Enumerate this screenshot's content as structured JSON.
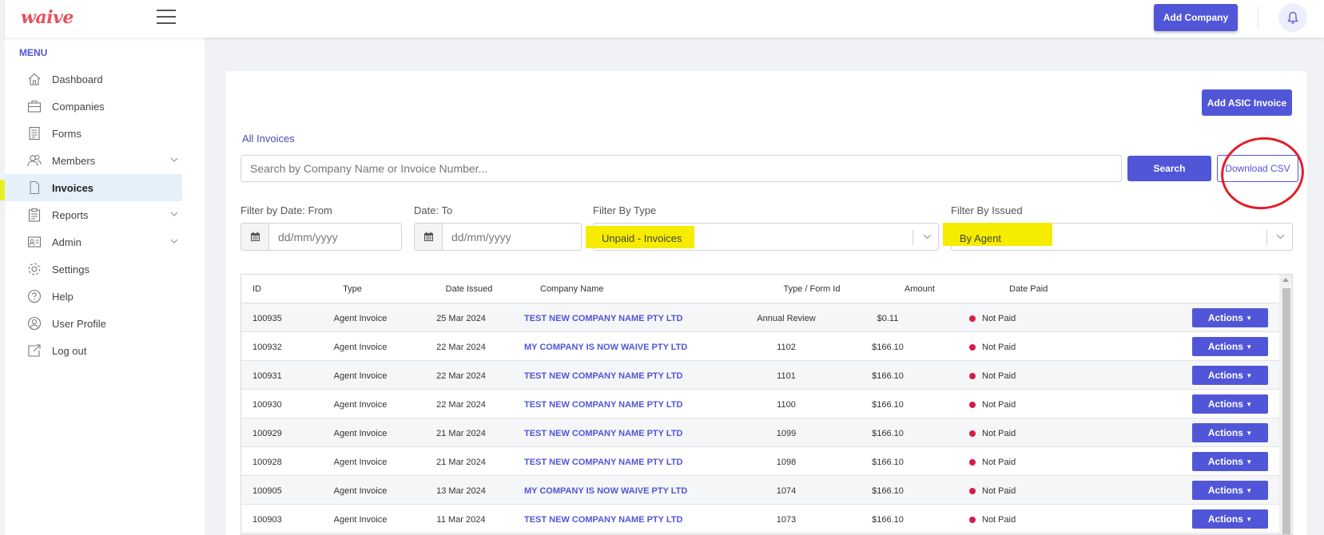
{
  "topbar": {
    "logo": "waive",
    "add_company_label": "Add Company"
  },
  "sidebar": {
    "menu_title": "MENU",
    "items": [
      {
        "label": "Dashboard",
        "icon": "home-icon"
      },
      {
        "label": "Companies",
        "icon": "briefcase-icon"
      },
      {
        "label": "Forms",
        "icon": "forms-icon"
      },
      {
        "label": "Members",
        "icon": "members-icon",
        "expandable": true
      },
      {
        "label": "Invoices",
        "icon": "file-icon",
        "active": true
      },
      {
        "label": "Reports",
        "icon": "clipboard-icon",
        "expandable": true
      },
      {
        "label": "Admin",
        "icon": "admin-icon",
        "expandable": true
      },
      {
        "label": "Settings",
        "icon": "gear-icon"
      },
      {
        "label": "Help",
        "icon": "help-icon"
      },
      {
        "label": "User Profile",
        "icon": "user-icon"
      },
      {
        "label": "Log out",
        "icon": "logout-icon"
      }
    ]
  },
  "main": {
    "add_asic_label": "Add ASIC Invoice",
    "section_title": "All Invoices",
    "search_placeholder": "Search by Company Name or Invoice Number...",
    "search_button": "Search",
    "download_csv_button": "Download CSV",
    "filters": {
      "date_from_label": "Filter by Date: From",
      "date_to_label": "Date: To",
      "date_placeholder": "dd/mm/yyyy",
      "type_label": "Filter By Type",
      "type_value": "Unpaid - Invoices",
      "issued_label": "Filter By Issued",
      "issued_value": "By Agent"
    },
    "table": {
      "columns": [
        "ID",
        "Type",
        "Date Issued",
        "Company Name",
        "Type / Form Id",
        "Amount",
        "Date Paid"
      ],
      "actions_label": "Actions",
      "rows": [
        {
          "id": "100935",
          "type": "Agent Invoice",
          "date": "25 Mar 2024",
          "company": "TEST NEW COMPANY NAME PTY LTD",
          "form": "Annual Review",
          "amount": "$0.11",
          "paid": "Not Paid"
        },
        {
          "id": "100932",
          "type": "Agent Invoice",
          "date": "22 Mar 2024",
          "company": "MY COMPANY IS NOW WAIVE PTY LTD",
          "form": "1102",
          "amount": "$166.10",
          "paid": "Not Paid"
        },
        {
          "id": "100931",
          "type": "Agent Invoice",
          "date": "22 Mar 2024",
          "company": "TEST NEW COMPANY NAME PTY LTD",
          "form": "1101",
          "amount": "$166.10",
          "paid": "Not Paid"
        },
        {
          "id": "100930",
          "type": "Agent Invoice",
          "date": "22 Mar 2024",
          "company": "TEST NEW COMPANY NAME PTY LTD",
          "form": "1100",
          "amount": "$166.10",
          "paid": "Not Paid"
        },
        {
          "id": "100929",
          "type": "Agent Invoice",
          "date": "21 Mar 2024",
          "company": "TEST NEW COMPANY NAME PTY LTD",
          "form": "1099",
          "amount": "$166.10",
          "paid": "Not Paid"
        },
        {
          "id": "100928",
          "type": "Agent Invoice",
          "date": "21 Mar 2024",
          "company": "TEST NEW COMPANY NAME PTY LTD",
          "form": "1098",
          "amount": "$166.10",
          "paid": "Not Paid"
        },
        {
          "id": "100905",
          "type": "Agent Invoice",
          "date": "13 Mar 2024",
          "company": "MY COMPANY IS NOW WAIVE PTY LTD",
          "form": "1074",
          "amount": "$166.10",
          "paid": "Not Paid"
        },
        {
          "id": "100903",
          "type": "Agent Invoice",
          "date": "11 Mar 2024",
          "company": "TEST NEW COMPANY NAME PTY LTD",
          "form": "1073",
          "amount": "$166.10",
          "paid": "Not Paid"
        }
      ]
    }
  },
  "colors": {
    "accent": "#5156d8",
    "status_not_paid": "#d81b47",
    "highlight_yellow": "#f5ec00",
    "annotation_red": "#e0202a"
  }
}
